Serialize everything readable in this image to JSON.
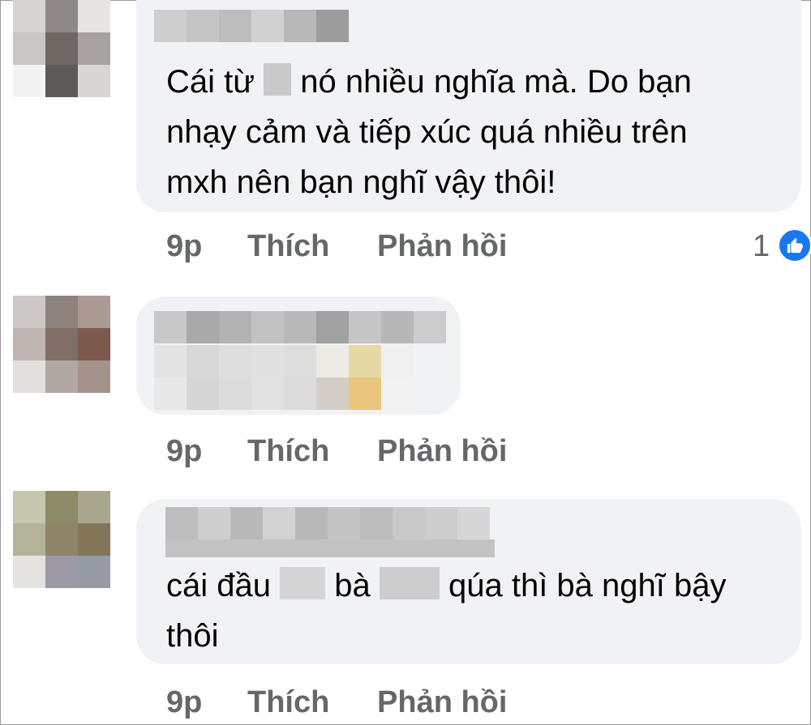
{
  "comments": [
    {
      "text_lines": [
        "Cái từ",
        "nó nhiều nghĩa mà. Do bạn",
        "nhạy cảm và tiếp xúc quá nhiều trên",
        "mxh nên bạn nghĩ vậy thôi!"
      ],
      "time": "9p",
      "like_label": "Thích",
      "reply_label": "Phản hồi",
      "reaction_count": "1"
    },
    {
      "time": "9p",
      "like_label": "Thích",
      "reply_label": "Phản hồi"
    },
    {
      "text_parts": [
        "cái đầu",
        "bà",
        "qúa thì bà nghĩ bậy"
      ],
      "text_line2": "thôi",
      "time": "9p",
      "like_label": "Thích",
      "reply_label": "Phản hồi"
    }
  ],
  "colors": {
    "bubble": "#f0f2f5",
    "action_text": "#65676b",
    "like_blue": "#1877f2"
  }
}
